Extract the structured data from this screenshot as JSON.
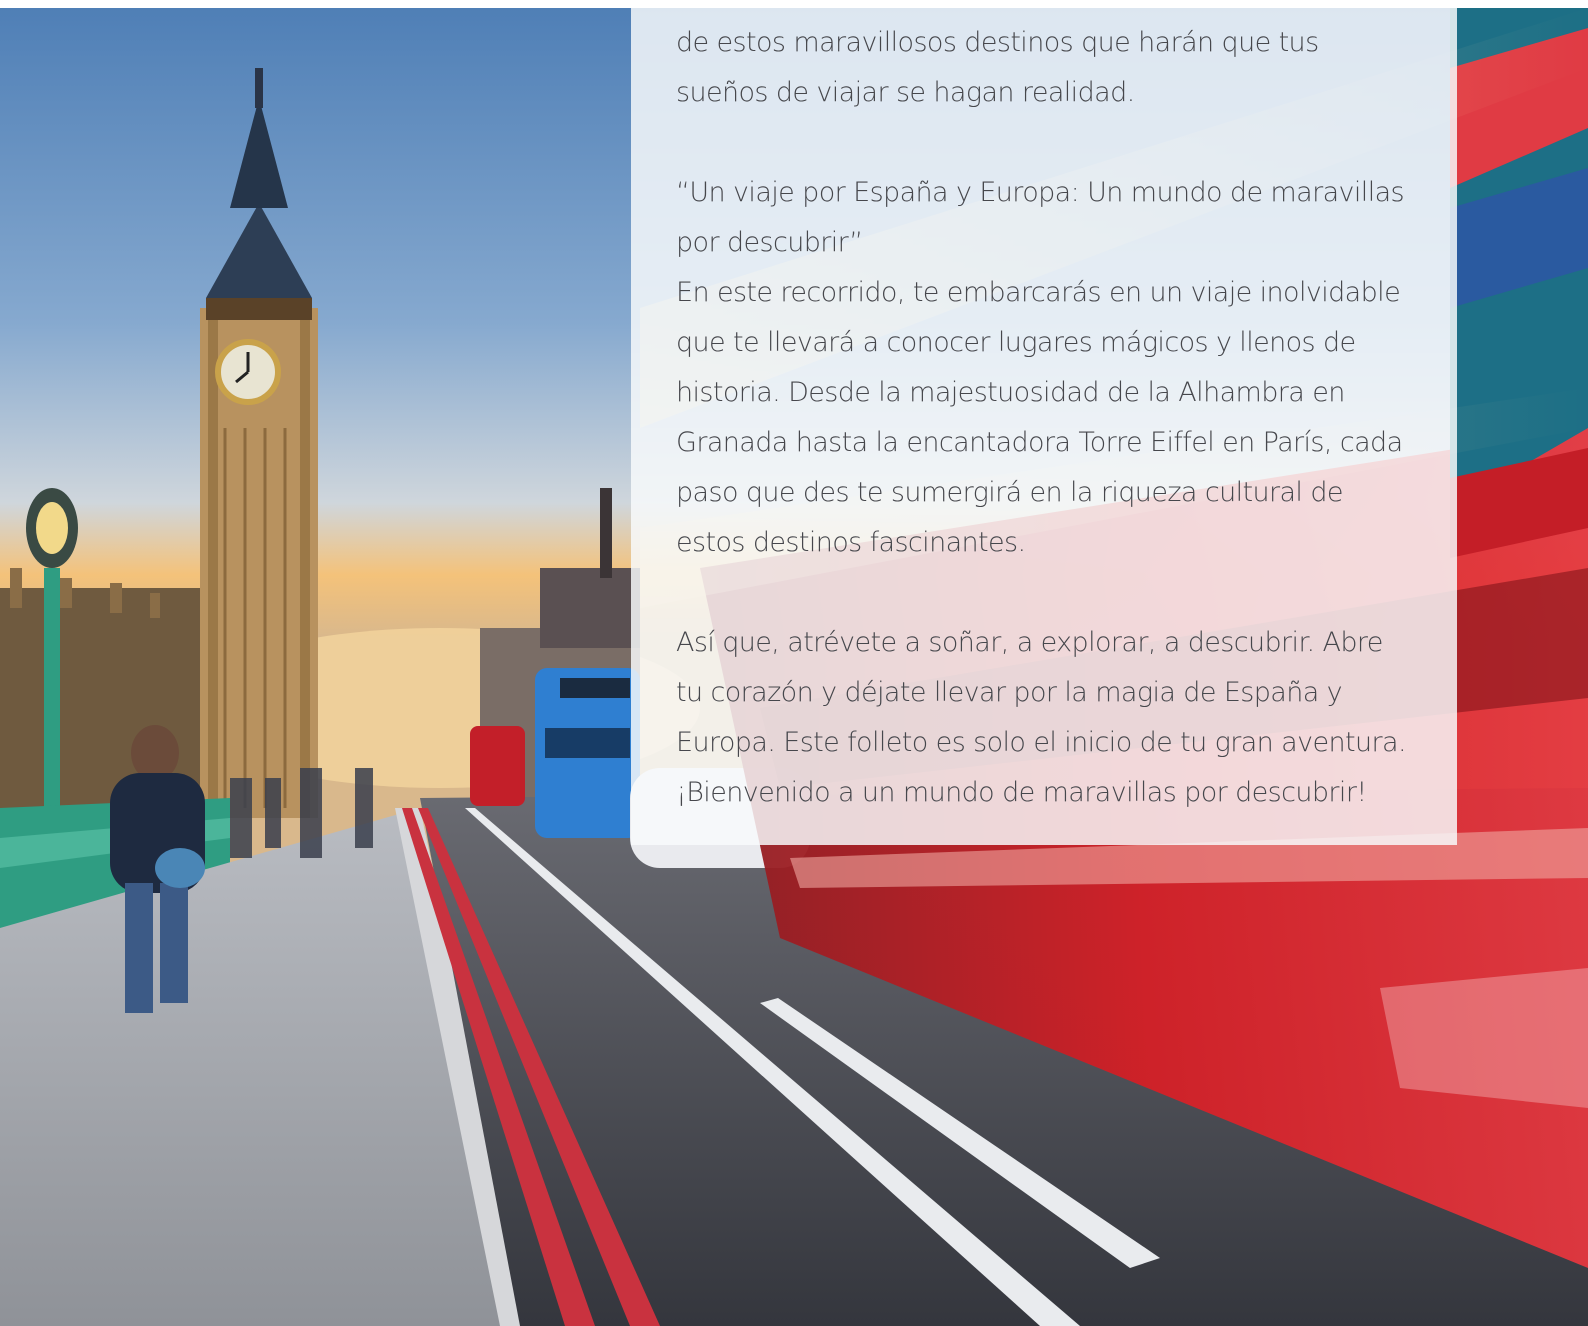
{
  "panel": {
    "paragraphs": [
      "de estos maravillosos destinos que harán que tus sueños de viajar se hagan realidad.",
      "“Un viaje por España y Europa: Un mundo de maravillas por descubrir”\nEn este recorrido, te embarcarás en un viaje inolvidable que te llevará a conocer lugares mágicos y llenos de historia. Desde la majestuosidad de la Alhambra en Granada hasta la encantadora Torre Eiffel en París, cada paso que des te sumergirá en la riqueza cultural de estos destinos fascinantes.",
      "Así que, atrévete a soñar, a explorar, a descubrir. Abre tu corazón y déjate llevar por la magia de España y Europa. Este folleto es solo el inicio de tu gran aventura. ¡Bienvenido a un mundo de maravillas por descubrir!"
    ]
  },
  "colors": {
    "sky_top": "#4f7fb6",
    "sky_horizon": "#f4c27a",
    "tower_stone": "#b8925f",
    "bus_red": "#d41f26",
    "bus_blue": "#2f7fd1",
    "road": "#3b3d44",
    "road_line_red": "#c9323f",
    "bridge_green": "#2f9d82"
  }
}
